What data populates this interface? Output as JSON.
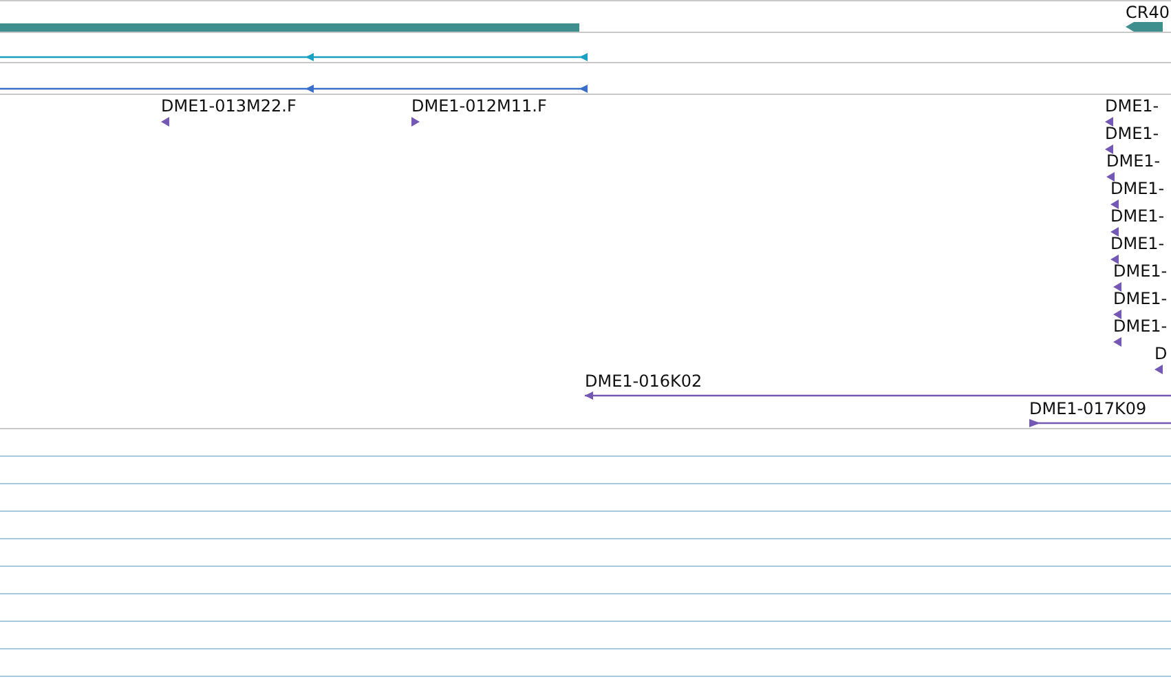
{
  "tracks": [
    {
      "kind": "gene",
      "features": [
        {
          "arrowhead": false
        },
        {
          "label": "CR40",
          "reverse": true
        }
      ]
    },
    {
      "kind": "transcript",
      "features": [
        {
          "reverse": true
        }
      ]
    },
    {
      "kind": "transcript2",
      "features": [
        {
          "reverse": true
        }
      ]
    },
    {
      "kind": "clone",
      "features": [
        {
          "label": "DME1-013M22.F",
          "reverse": true
        },
        {
          "label": "DME1-012M11.F",
          "reverse": false
        },
        {
          "label": "DME1-",
          "reverse": true
        },
        {
          "label": "DME1-",
          "reverse": true
        },
        {
          "label": "DME1-",
          "reverse": true
        },
        {
          "label": "DME1-",
          "reverse": true
        },
        {
          "label": "DME1-",
          "reverse": true
        },
        {
          "label": "DME1-",
          "reverse": true
        },
        {
          "label": "DME1-",
          "reverse": true
        },
        {
          "label": "DME1-",
          "reverse": true
        },
        {
          "label": "DME1-",
          "reverse": true
        },
        {
          "label": "D",
          "reverse": true
        },
        {
          "label": "DME1-016K02",
          "reverse": true
        },
        {
          "label": "DME1-017K09",
          "reverse": false
        }
      ]
    }
  ]
}
